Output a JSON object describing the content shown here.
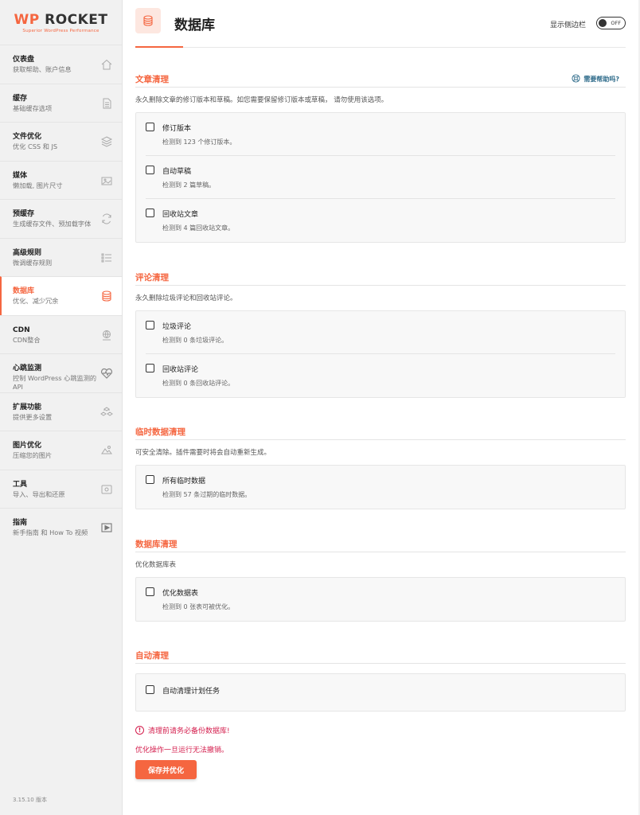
{
  "logo": {
    "prefix": "WP",
    "name": "ROCKET",
    "tagline": "Superior WordPress Performance"
  },
  "nav": [
    {
      "title": "仪表盘",
      "desc": "获取帮助、账户信息",
      "icon": "house-icon"
    },
    {
      "title": "缓存",
      "desc": "基础缓存选项",
      "icon": "document-icon"
    },
    {
      "title": "文件优化",
      "desc": "优化 CSS 和 JS",
      "icon": "layers-icon"
    },
    {
      "title": "媒体",
      "desc": "懒加载, 图片尺寸",
      "icon": "media-icon"
    },
    {
      "title": "预缓存",
      "desc": "生成缓存文件、预加载字体",
      "icon": "refresh-icon"
    },
    {
      "title": "高级规则",
      "desc": "微调缓存规则",
      "icon": "list-icon"
    },
    {
      "title": "数据库",
      "desc": "优化、减少冗余",
      "icon": "database-icon",
      "active": true
    },
    {
      "title": "CDN",
      "desc": "CDN整合",
      "icon": "cdn-icon"
    },
    {
      "title": "心跳监测",
      "desc": "控制 WordPress 心跳监测的 API",
      "icon": "heartbeat-icon"
    },
    {
      "title": "扩展功能",
      "desc": "提供更多设置",
      "icon": "addons-icon"
    },
    {
      "title": "图片优化",
      "desc": "压缩您的图片",
      "icon": "image-icon"
    },
    {
      "title": "工具",
      "desc": "导入、导出和还原",
      "icon": "tools-icon"
    },
    {
      "title": "指南",
      "desc": "新手指南 和 How To 视频",
      "icon": "video-icon"
    }
  ],
  "version": "3.15.10 版本",
  "header": {
    "title": "数据库",
    "sidebar_toggle_label": "显示侧边栏",
    "toggle_state": "OFF"
  },
  "help_label": "需要帮助吗?",
  "sections": [
    {
      "title": "文章清理",
      "desc": "永久删除文章的修订版本和草稿。如您需要保留修订版本或草稿， 请勿使用该选项。",
      "options": [
        {
          "label": "修订版本",
          "sub": "检测到 123 个修订版本。"
        },
        {
          "label": "自动草稿",
          "sub": "检测到 2 篇草稿。"
        },
        {
          "label": "回收站文章",
          "sub": "检测到 4 篇回收站文章。"
        }
      ]
    },
    {
      "title": "评论清理",
      "desc": "永久删除垃圾评论和回收站评论。",
      "options": [
        {
          "label": "垃圾评论",
          "sub": "检测到 0 条垃圾评论。"
        },
        {
          "label": "回收站评论",
          "sub": "检测到 0 条回收站评论。"
        }
      ]
    },
    {
      "title": "临时数据清理",
      "desc": "可安全清除。插件需要时将会自动重新生成。",
      "options": [
        {
          "label": "所有临时数据",
          "sub": "检测到 57 条过期的临时数据。"
        }
      ]
    },
    {
      "title": "数据库清理",
      "desc": "优化数据库表",
      "options": [
        {
          "label": "优化数据表",
          "sub": "检测到 0 张表可被优化。"
        }
      ]
    },
    {
      "title": "自动清理",
      "desc": "",
      "options": [
        {
          "label": "自动清理计划任务",
          "sub": ""
        }
      ]
    }
  ],
  "warning": {
    "line1": "清理前请务必备份数据库!",
    "line2": "优化操作一旦运行无法撤销。"
  },
  "save_button": "保存并优化",
  "colors": {
    "accent": "#f56640",
    "danger": "#d41f4e",
    "help": "#2e6b8a"
  }
}
